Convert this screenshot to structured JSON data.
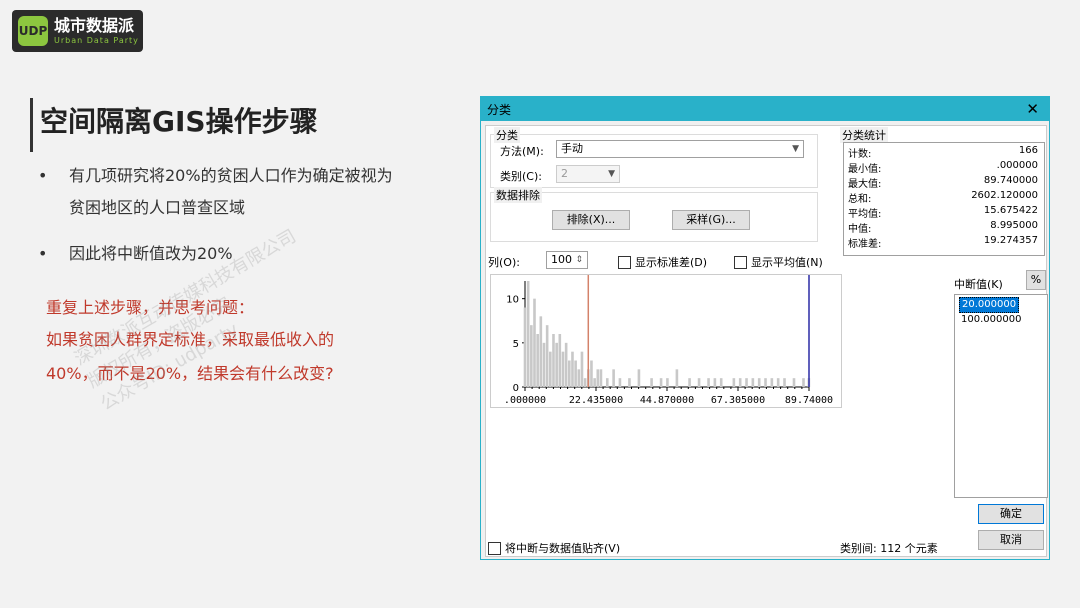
{
  "logo": {
    "mark": "UDP",
    "name": "城市数据派",
    "subtitle": "Urban Data Party"
  },
  "slide": {
    "title": "空间隔离GIS操作步骤",
    "bullets": [
      {
        "symbol": "•",
        "lines": [
          "有几项研究将20%的贫困人口作为确定被视为",
          "贫困地区的人口普查区域"
        ]
      },
      {
        "symbol": "•",
        "lines": [
          "因此将中断值改为20%"
        ]
      }
    ],
    "question_lines": [
      "重复上述步骤，并思考问题：",
      "如果贫困人群界定标准，采取最低收入的",
      "40%，而不是20%，结果会有什么改变?"
    ]
  },
  "watermarks": [
    [
      "深圳数派互动传媒科技有限公司",
      "版权所有，盗版必究",
      "公众号ID: udparty"
    ]
  ],
  "dialog": {
    "title": "分类",
    "close": "✕",
    "classification": {
      "group_label": "分类",
      "method_label": "方法(M):",
      "method_value": "手动",
      "count_label": "类别(C):",
      "count_value": "2"
    },
    "exclusion": {
      "group_label": "数据排除",
      "exclude_button": "排除(X)...",
      "sample_button": "采样(G)..."
    },
    "columns": {
      "label": "列(O):",
      "value": "100",
      "show_std": "显示标准差(D)",
      "show_mean": "显示平均值(N)"
    },
    "stats": {
      "group_label": "分类统计",
      "rows": [
        {
          "k": "计数:",
          "v": "166"
        },
        {
          "k": "最小值:",
          "v": ".000000"
        },
        {
          "k": "最大值:",
          "v": "89.740000"
        },
        {
          "k": "总和:",
          "v": "2602.120000"
        },
        {
          "k": "平均值:",
          "v": "15.675422"
        },
        {
          "k": "中值:",
          "v": "8.995000"
        },
        {
          "k": "标准差:",
          "v": "19.274357"
        }
      ]
    },
    "breaks": {
      "label": "中断值(K)",
      "percent_button": "%",
      "items": [
        "20.000000",
        "100.000000"
      ]
    },
    "ok_button": "确定",
    "cancel_button": "取消",
    "snap_label": "将中断与数据值贴齐(V)",
    "status": "类别间: 112 个元素"
  },
  "chart_data": {
    "type": "bar",
    "yticks": [
      "0",
      "5",
      "10"
    ],
    "xticks": [
      ".000000",
      "22.435000",
      "44.870000",
      "67.305000",
      "89.74000"
    ],
    "xlim": [
      0,
      89.74
    ],
    "ylim": [
      0,
      12
    ],
    "break_lines": [
      20,
      89.74
    ],
    "bins_x": [
      0,
      1,
      2,
      3,
      4,
      5,
      6,
      7,
      8,
      9,
      10,
      11,
      12,
      13,
      14,
      15,
      16,
      17,
      18,
      19,
      20,
      21,
      22,
      23,
      24,
      26,
      28,
      30,
      33,
      36,
      40,
      43,
      45,
      48,
      52,
      55,
      58,
      60,
      62,
      66,
      68,
      70,
      72,
      74,
      76,
      78,
      80,
      82,
      85,
      88,
      89.7
    ],
    "bins_y": [
      9,
      12,
      7,
      10,
      6,
      8,
      5,
      7,
      4,
      6,
      5,
      6,
      4,
      5,
      3,
      4,
      3,
      2,
      4,
      1,
      2,
      3,
      1,
      2,
      2,
      1,
      2,
      1,
      1,
      2,
      1,
      1,
      1,
      2,
      1,
      1,
      1,
      1,
      1,
      1,
      1,
      1,
      1,
      1,
      1,
      1,
      1,
      1,
      1,
      1,
      1
    ]
  }
}
